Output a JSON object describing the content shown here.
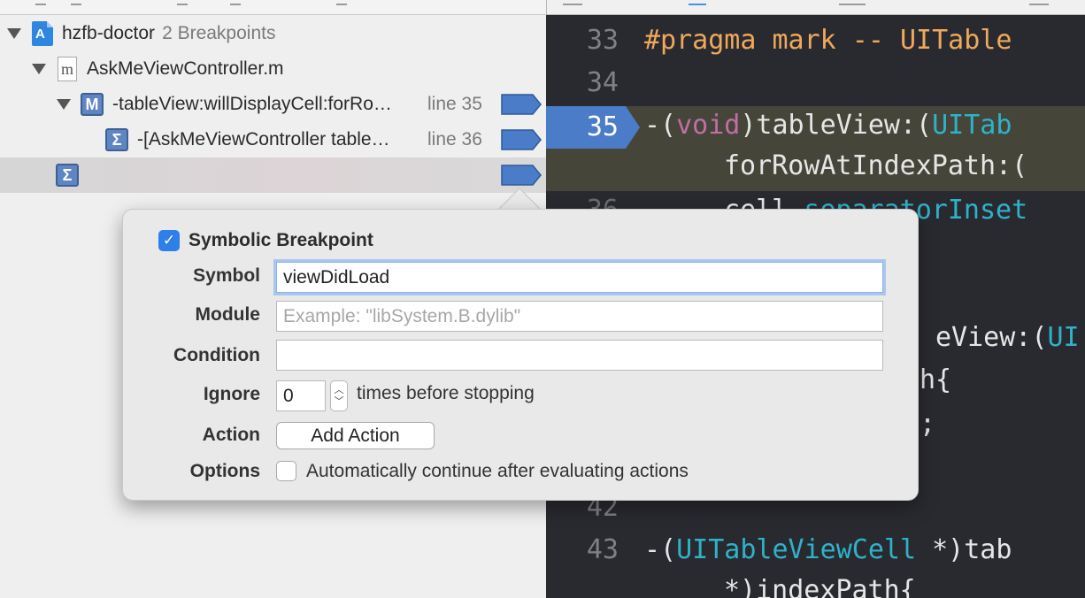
{
  "navigator": {
    "project": {
      "name": "hzfb-doctor",
      "count": "2 Breakpoints"
    },
    "file": {
      "name": "AskMeViewController.m",
      "icon_letter": "m"
    },
    "breakpoints": [
      {
        "icon_letter": "M",
        "label": "-tableView:willDisplayCell:forRo…",
        "line": "line 35"
      },
      {
        "icon_letter": "Σ",
        "label": "-[AskMeViewController table…",
        "line": "line 36"
      },
      {
        "icon_letter": "Σ",
        "label": "",
        "line": ""
      }
    ]
  },
  "editor": {
    "lines": [
      {
        "num": "33"
      },
      {
        "num": "34"
      },
      {
        "num": "35"
      },
      {
        "num": "36"
      },
      {
        "num": "42"
      },
      {
        "num": "43"
      }
    ],
    "code": {
      "pragma": "#pragma mark -- UITable",
      "l35_dash": "-(",
      "l35_void": "void",
      "l35_mid": ")tableView:(",
      "l35_type": "UITab",
      "l35b": "forRowAtIndexPath:(",
      "l36_plain": "cell.",
      "l36_type": "separatorInset",
      "l39_plain": "eView:(",
      "l39_type": "UI",
      "l40": "h{",
      "l41": ";",
      "l43_dash": "-(",
      "l43_type": "UITableViewCell",
      "l43_rest": " *)tab",
      "l44": "*)indexPath{"
    }
  },
  "popover": {
    "title": "Symbolic Breakpoint",
    "enabled": true,
    "symbol_label": "Symbol",
    "symbol_value": "viewDidLoad",
    "module_label": "Module",
    "module_placeholder": "Example: \"libSystem.B.dylib\"",
    "condition_label": "Condition",
    "condition_value": "",
    "ignore_label": "Ignore",
    "ignore_value": "0",
    "ignore_suffix": "times before stopping",
    "action_label": "Action",
    "add_action_button": "Add Action",
    "options_label": "Options",
    "options_checkbox": "Automatically continue after evaluating actions"
  },
  "colors": {
    "breakpoint_blue": "#4a7cc7",
    "editor_bg": "#292a30",
    "checkbox_blue": "#2f7fe9"
  }
}
